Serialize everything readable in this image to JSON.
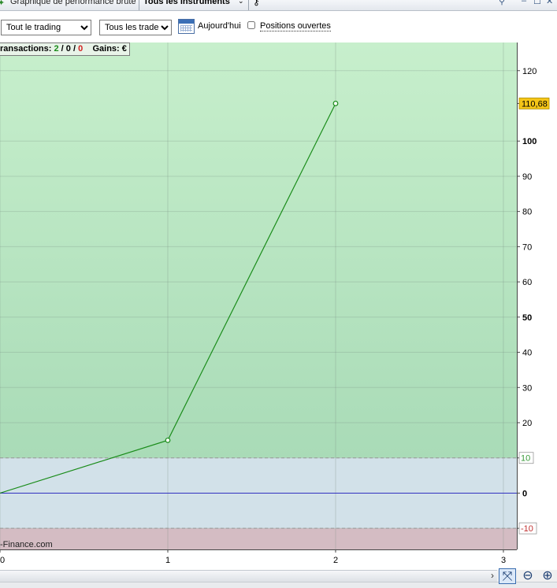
{
  "header": {
    "title": "Graphique de performance brute",
    "instrument_selector": "Tous les instruments"
  },
  "toolbar": {
    "scope_select": {
      "value": "Tout le trading",
      "options": [
        "Tout le trading"
      ]
    },
    "trades_select": {
      "value": "Tous les trades",
      "options": [
        "Tous les trades"
      ]
    },
    "today_label": "Aujourd'hui",
    "open_positions_label": "Positions ouvertes",
    "open_positions_checked": false
  },
  "summary": {
    "transactions_label": "ransactions:",
    "total": "2",
    "sep1": "/",
    "neutral": "0",
    "sep2": "/",
    "losing": "0",
    "gains_label": "Gains:",
    "gains_unit": "€"
  },
  "watermark": "-Finance.com",
  "colors": {
    "profit_zone": "#c7efcc",
    "neutral_zone": "#d2e1e9",
    "loss_zone": "#d4bcc3",
    "line": "#1a8c1a",
    "zero_line": "#3030c0",
    "last_value_badge": "#f5c518"
  },
  "chart_data": {
    "type": "line",
    "x": [
      0,
      1,
      2
    ],
    "y": [
      0,
      15,
      110.68
    ],
    "xlim": [
      0,
      3.08
    ],
    "ylim": [
      -16,
      128
    ],
    "x_ticks": [
      0,
      1,
      2,
      3
    ],
    "y_ticks": [
      120,
      110.68,
      100,
      90,
      80,
      70,
      60,
      50,
      40,
      30,
      20,
      10,
      0,
      -10
    ],
    "y_tick_labels": [
      "120",
      "110,68",
      "100",
      "90",
      "80",
      "70",
      "60",
      "50",
      "40",
      "30",
      "20",
      "10",
      "0",
      "-10"
    ],
    "bold_ticks": [
      100,
      50,
      0
    ],
    "upper_threshold": 10,
    "lower_threshold": -10,
    "last_value": 110.68,
    "last_value_label": "110,68",
    "grid": true
  },
  "icons": {
    "zoom_auto": "zoom-fit-icon",
    "zoom_out": "zoom-out-icon",
    "zoom_in": "zoom-in-icon"
  }
}
